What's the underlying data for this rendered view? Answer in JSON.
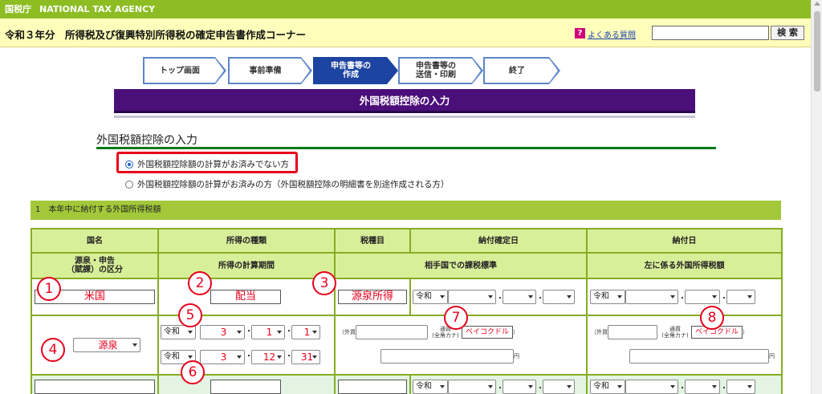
{
  "topbar": {
    "agency_jp": "国税庁",
    "agency_en": "NATIONAL TAX AGENCY"
  },
  "header": {
    "title": "令和３年分　所得税及び復興特別所得税の確定申告書作成コーナー",
    "faq_label": "よくある質問",
    "faq_icon_glyph": "?",
    "search_value": "",
    "search_button": "検 索"
  },
  "steps": [
    {
      "label": "トップ画面",
      "active": false
    },
    {
      "label": "事前準備",
      "active": false
    },
    {
      "label": "申告書等の\n作成",
      "active": true
    },
    {
      "label": "申告書等の\n送信・印刷",
      "active": false
    },
    {
      "label": "終了",
      "active": false
    }
  ],
  "banner": "外国税額控除の入力",
  "section_title": "外国税額控除の入力",
  "radios": [
    {
      "label": "外国税額控除額の計算がお済みでない方",
      "selected": true
    },
    {
      "label": "外国税額控除額の計算がお済みの方（外国税額控除の明細書を別途作成される方）",
      "selected": false
    }
  ],
  "subbar": "1　本年中に納付する外国所得税額",
  "table": {
    "h1": [
      "国名",
      "所得の種類",
      "税種目",
      "納付確定日",
      "納付日"
    ],
    "h2": [
      "源泉・申告\n（賦課）の区分",
      "所得の計算期間",
      "相手国での課税標準",
      "左に係る外国所得税額"
    ],
    "row1": {
      "country": "米国",
      "income_type": "配当",
      "tax_item": "源泉所得",
      "era1": "令和",
      "era2": "令和"
    },
    "row2": {
      "category": "源泉",
      "start_era": "令和",
      "start_year": "3",
      "start_month": "1",
      "start_day": "1",
      "end_era": "令和",
      "end_year": "3",
      "end_month": "12",
      "end_day": "31",
      "foreign_label": "（外貨",
      "currency_label_1": "通貨",
      "currency_label_2": "(全角カナ)",
      "currency_value": "ベイコクドル",
      "close_paren": "）",
      "yen": "円"
    },
    "row3": {
      "era1": "令和",
      "era2": "令和"
    }
  },
  "markers": [
    "1",
    "2",
    "3",
    "4",
    "5",
    "6",
    "7",
    "8"
  ],
  "colors": {
    "top_green": "#8dbd22",
    "header_yellow": "#ffffbb",
    "banner_purple": "#4b0f7a",
    "step_active": "#1d44a0",
    "marker_red": "#e8001c",
    "table_border": "#86ad22"
  }
}
